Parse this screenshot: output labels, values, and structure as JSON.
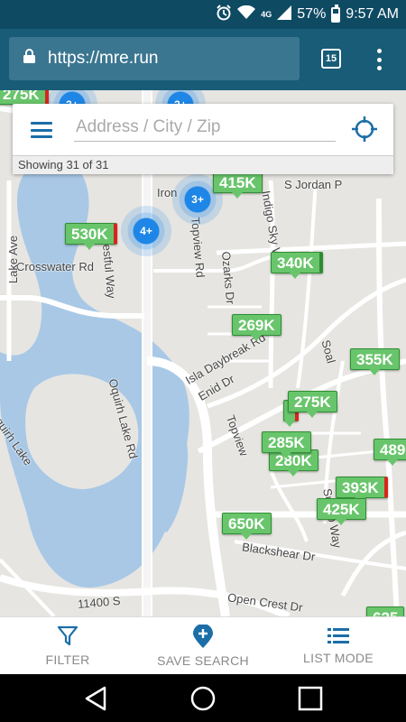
{
  "status_bar": {
    "alarm_icon": "alarm-icon",
    "wifi_icon": "wifi-icon",
    "network": "4G",
    "battery": "57%",
    "time": "9:57 AM"
  },
  "browser": {
    "url": "https://mre.run",
    "tab_count": "15"
  },
  "search": {
    "placeholder": "Address / City / Zip",
    "showing": "Showing 31 of 31"
  },
  "map": {
    "streets": {
      "crosswater": "Crosswater Rd",
      "lake_ave": "Lake Ave",
      "oquirh_lake_rd": "Oquirh Lake Rd",
      "isla": "Isla Daybreak Rd",
      "enid": "Enid Dr",
      "topview": "Topview",
      "topview_rd": "Topview Rd",
      "ozarks": "Ozarks Dr",
      "indigo": "Indigo Sky Way",
      "iron": "Iron",
      "jordan": "S Jordan P",
      "westful": "estful Way",
      "blackshear": "Blackshear Dr",
      "open_crest": "Open Crest Dr",
      "s11400": "11400 S",
      "soal": "Soal",
      "sunup": "Sunup Way",
      "oquirh_lake": "quirh Lake"
    },
    "prices": {
      "p275a": "275K",
      "p415": "415K",
      "p530": "530K",
      "p340": "340K",
      "p269": "269K",
      "p355": "355K",
      "p275b": "275K",
      "p285": "285K",
      "p280": "280K",
      "p393": "393K",
      "p425": "425K",
      "p650": "650K",
      "p489": "489",
      "p625": "625"
    },
    "clusters": {
      "c1": "3+",
      "c2": "4+",
      "c3": "3+",
      "c4": "3+"
    }
  },
  "actions": {
    "filter": "FILTER",
    "save_search": "SAVE SEARCH",
    "list_mode": "LIST MODE"
  },
  "colors": {
    "price_green": "#69c56b",
    "cluster_blue": "#1e86e6",
    "water": "#a8c8e6",
    "accent": "#1b6ea8"
  }
}
